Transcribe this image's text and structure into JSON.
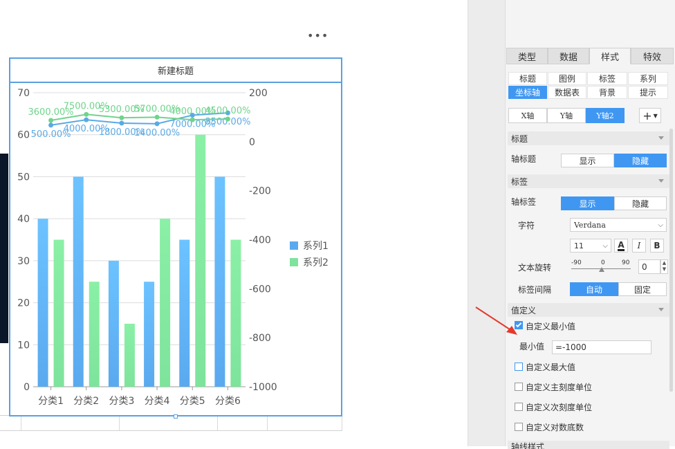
{
  "chart": {
    "title": "新建标题",
    "more": "•••"
  },
  "chart_data": {
    "type": "bar",
    "categories": [
      "分类1",
      "分类2",
      "分类3",
      "分类4",
      "分类5",
      "分类6"
    ],
    "series": [
      {
        "name": "系列1",
        "values": [
          40,
          50,
          30,
          25,
          35,
          50
        ],
        "color": "#5aa9ef"
      },
      {
        "name": "系列2",
        "values": [
          35,
          25,
          15,
          40,
          60,
          35
        ],
        "color": "#7ee39c"
      }
    ],
    "ylim": [
      0,
      70
    ],
    "yticks": [
      0,
      10,
      20,
      30,
      40,
      50,
      60,
      70
    ],
    "y2lim": [
      -1000,
      200
    ],
    "y2ticks": [
      "200",
      "0",
      "-200",
      "-400",
      "-600",
      "-800",
      "-1000"
    ],
    "line_series": [
      {
        "values": [
          500,
          4000,
          1800,
          1400,
          7000,
          8500
        ],
        "labels": [
          "500.00%",
          "4000.00%",
          "1800.00%",
          "1400.00%",
          "7000.00%",
          "8500.00%"
        ],
        "color": "#5aa9e6"
      },
      {
        "values": [
          3600,
          7500,
          5300,
          5700,
          4000,
          4500
        ],
        "labels": [
          "3600.00%",
          "7500.00%",
          "5300.00%",
          "5700.00%",
          "4000.00%",
          "4500.00%"
        ],
        "color": "#6fd48c"
      }
    ],
    "legend_position": "right",
    "grid": true
  },
  "panel": {
    "tabs": [
      {
        "label": "类型",
        "active": false
      },
      {
        "label": "数据",
        "active": false
      },
      {
        "label": "样式",
        "active": true
      },
      {
        "label": "特效",
        "active": false
      }
    ],
    "subtabs_row1": [
      "标题",
      "图例",
      "标签",
      "系列"
    ],
    "subtabs_row2": [
      "坐标轴",
      "数据表",
      "背景",
      "提示"
    ],
    "axis_buttons": [
      "X轴",
      "Y轴",
      "Y轴2"
    ],
    "add_button": "+",
    "sec_title": "标题",
    "axis_title_label": "轴标题",
    "show": "显示",
    "hide": "隐藏",
    "sec_label": "标签",
    "axis_label_label": "轴标签",
    "font_label": "字符",
    "font_value": "Verdana",
    "font_size": "11",
    "bold": "B",
    "italic": "I",
    "color_a": "A",
    "rotate_label": "文本旋转",
    "rotate_min": "-90",
    "rotate_mid": "0",
    "rotate_max": "90",
    "rotate_value": "0",
    "interval_label": "标签间隔",
    "auto": "自动",
    "fixed": "固定",
    "sec_value": "值定义",
    "custom_min": "自定义最小值",
    "min_label": "最小值",
    "min_value": "=-1000",
    "custom_max": "自定义最大值",
    "custom_major": "自定义主刻度单位",
    "custom_minor": "自定义次刻度单位",
    "custom_log": "自定义对数底数",
    "sec_axis_line": "轴线样式"
  }
}
